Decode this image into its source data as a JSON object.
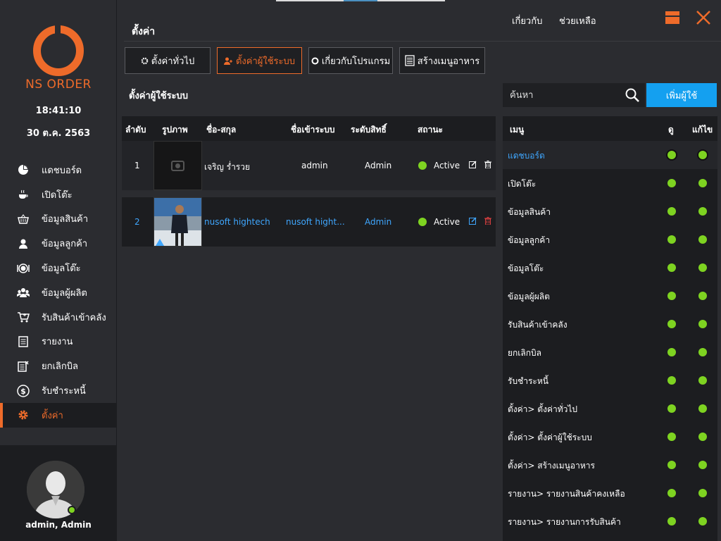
{
  "app": {
    "brand": "NS ORDER",
    "time": "18:41:10",
    "date": "30 ต.ค. 2563"
  },
  "colors": {
    "accent": "#ee6b2a",
    "active_green": "#7ed321",
    "link_blue": "#3fa7ff",
    "button_blue": "#14a0f0"
  },
  "sidebar": {
    "items": [
      {
        "label": "แดชบอร์ด",
        "icon": "pie-chart-icon"
      },
      {
        "label": "เปิดโต๊ะ",
        "icon": "coffee-cup-icon"
      },
      {
        "label": "ข้อมูลสินค้า",
        "icon": "basket-icon"
      },
      {
        "label": "ข้อมูลลูกค้า",
        "icon": "person-icon"
      },
      {
        "label": "ข้อมูลโต๊ะ",
        "icon": "dish-icon"
      },
      {
        "label": "ข้อมูลผู้ผลิต",
        "icon": "group-icon"
      },
      {
        "label": "รับสินค้าเข้าคลัง",
        "icon": "cart-icon"
      },
      {
        "label": "รายงาน",
        "icon": "report-icon"
      },
      {
        "label": "ยกเลิกบิล",
        "icon": "cancel-doc-icon"
      },
      {
        "label": "รับชำระหนี้",
        "icon": "dollar-icon"
      },
      {
        "label": "ตั้งค่า",
        "icon": "gear-icon"
      }
    ],
    "user": {
      "name": "admin, Admin"
    }
  },
  "header": {
    "title": "ตั้งค่า",
    "about_link": "เกี่ยวกับ",
    "help_link": "ช่วยเหลือ"
  },
  "tabs": [
    {
      "label": "ตั้งค่าทั่วไป",
      "icon": "gear-icon"
    },
    {
      "label": "ตั้งค่าผู้ใช้ระบบ",
      "icon": "users-icon"
    },
    {
      "label": "เกี่ยวกับโปรแกรม",
      "icon": "circle-icon"
    },
    {
      "label": "สร้างเมนูอาหาร",
      "icon": "document-icon"
    }
  ],
  "section": {
    "title": "ตั้งค่าผู้ใช้ระบบ"
  },
  "search": {
    "placeholder": "ค้นหา",
    "add_button": "เพิ่มผู้ใช้"
  },
  "users_table": {
    "headers": {
      "index": "ลำดับ",
      "photo": "รูปภาพ",
      "fullname": "ชื่อ-สกุล",
      "username": "ชื่อเข้าระบบ",
      "role": "ระดับสิทธิ์",
      "status": "สถานะ"
    },
    "rows": [
      {
        "index": "1",
        "fullname": "เจริญ ร่ำรวย",
        "username": "admin",
        "role": "Admin",
        "status": "Active"
      },
      {
        "index": "2",
        "fullname": "nusoft hightech",
        "username": "nusoft hight...",
        "role": "Admin",
        "status": "Active"
      }
    ]
  },
  "perm_table": {
    "headers": {
      "menu": "เมนู",
      "view": "ดู",
      "edit": "แก้ไข"
    },
    "rows": [
      "แดชบอร์ด",
      "เปิดโต๊ะ",
      "ข้อมูลสินค้า",
      "ข้อมูลลูกค้า",
      "ข้อมูลโต๊ะ",
      "ข้อมูลผู้ผลิต",
      "รับสินค้าเข้าคลัง",
      "ยกเลิกบิล",
      "รับชำระหนี้",
      "ตั้งค่า> ตั้งค่าทั่วไป",
      "ตั้งค่า> ตั้งค่าผู้ใช้ระบบ",
      "ตั้งค่า> สร้างเมนูอาหาร",
      "รายงาน> รายงานสินค้าคงเหลือ",
      "รายงาน> รายงานการรับสินค้า"
    ]
  }
}
